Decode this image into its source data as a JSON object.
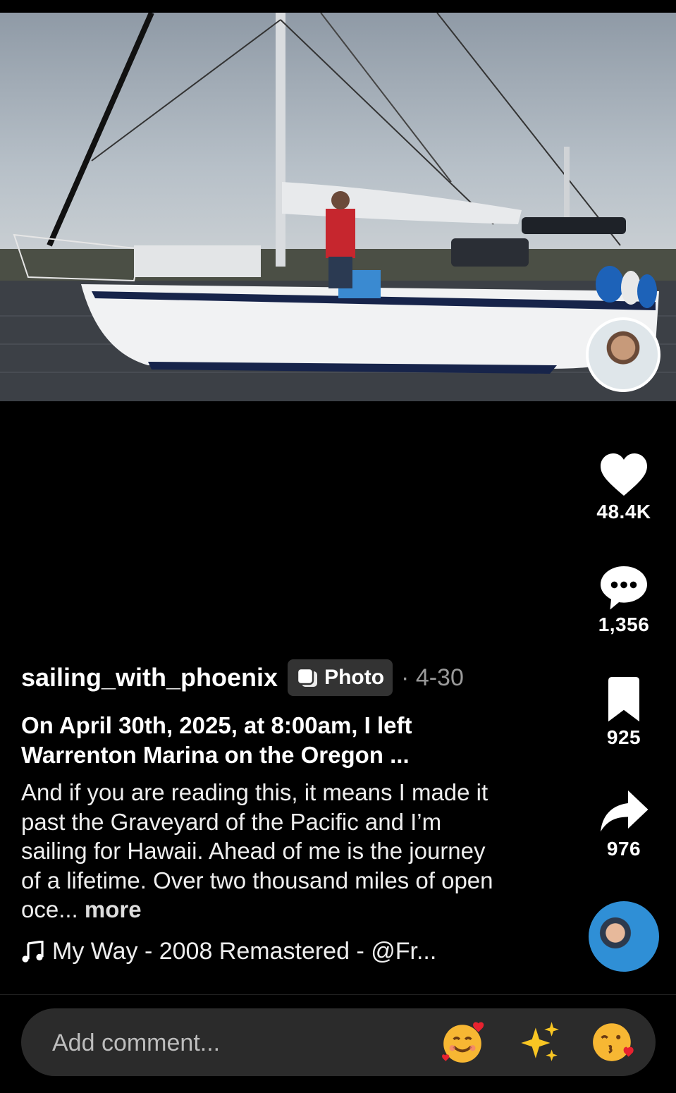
{
  "post": {
    "username": "sailing_with_phoenix",
    "badge_label": "Photo",
    "date": "· 4-30",
    "title": "On April 30th, 2025, at 8:00am, I left Warrenton Marina on the Oregon ...",
    "body": "And if you are reading this, it means I made it past the Graveyard of the Pacific and I’m sailing for Hawaii. Ahead of me is the journey of a lifetime. Over two thousand miles of open oce...",
    "more_label": "more",
    "music": "My Way - 2008 Remastered - @Fr..."
  },
  "actions": {
    "likes": "48.4K",
    "comments": "1,356",
    "saves": "925",
    "shares": "976"
  },
  "comment": {
    "placeholder": "Add comment..."
  },
  "icons": {
    "like": "heart-icon",
    "comment": "comment-bubble-icon",
    "save": "bookmark-icon",
    "share": "share-arrow-icon",
    "music": "music-note-icon",
    "badge": "photo-stack-icon",
    "emoji_1": "smiling-face-with-hearts",
    "emoji_2": "sparkles",
    "emoji_3": "face-blowing-kiss"
  },
  "colors": {
    "background": "#000000",
    "comment_bar": "#2b2b2b",
    "badge_bg": "#333333",
    "muted_text": "#9a9a9a"
  }
}
